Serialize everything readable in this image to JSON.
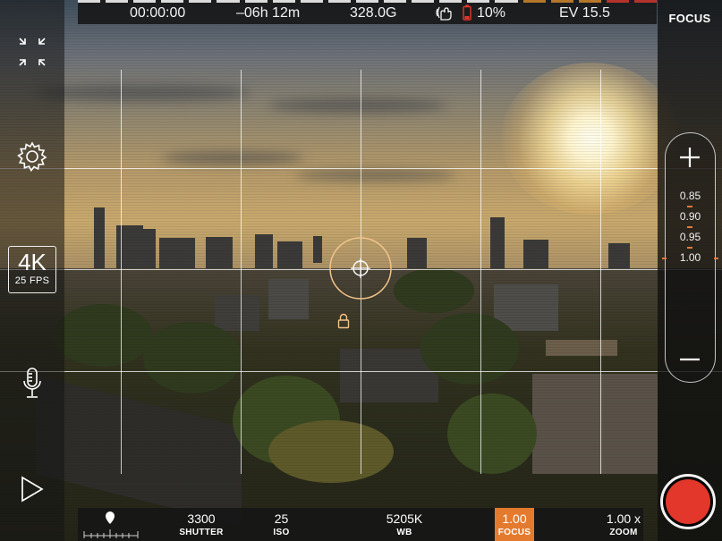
{
  "status_bar": {
    "timecode": "00:00:00",
    "remaining": "–06h 12m",
    "storage": "328.0G",
    "battery": "10%",
    "ev": "EV 15.5"
  },
  "mode_label": "FOCUS",
  "resolution": {
    "res": "4K",
    "fps": "25 FPS"
  },
  "focus_scale": [
    "0.85",
    "0.90",
    "0.95",
    "1.00"
  ],
  "controls": [
    {
      "value": "3300",
      "label": "SHUTTER"
    },
    {
      "value": "25",
      "label": "ISO"
    },
    {
      "value": "5205K",
      "label": "WB"
    },
    {
      "value": "1.00",
      "label": "FOCUS"
    },
    {
      "value": "1.00 x",
      "label": "ZOOM"
    }
  ],
  "colors": {
    "accent": "#e47a2e",
    "record": "#e2372a",
    "battery_low": "#e2372a"
  },
  "icons": {
    "collapse": "collapse-arrows-icon",
    "settings": "gear-icon",
    "mic": "microphone-icon",
    "play": "play-icon",
    "stabilizer": "hand-stabilizer-icon",
    "battery": "battery-icon",
    "location": "location-pin-icon",
    "lock": "lock-icon"
  }
}
